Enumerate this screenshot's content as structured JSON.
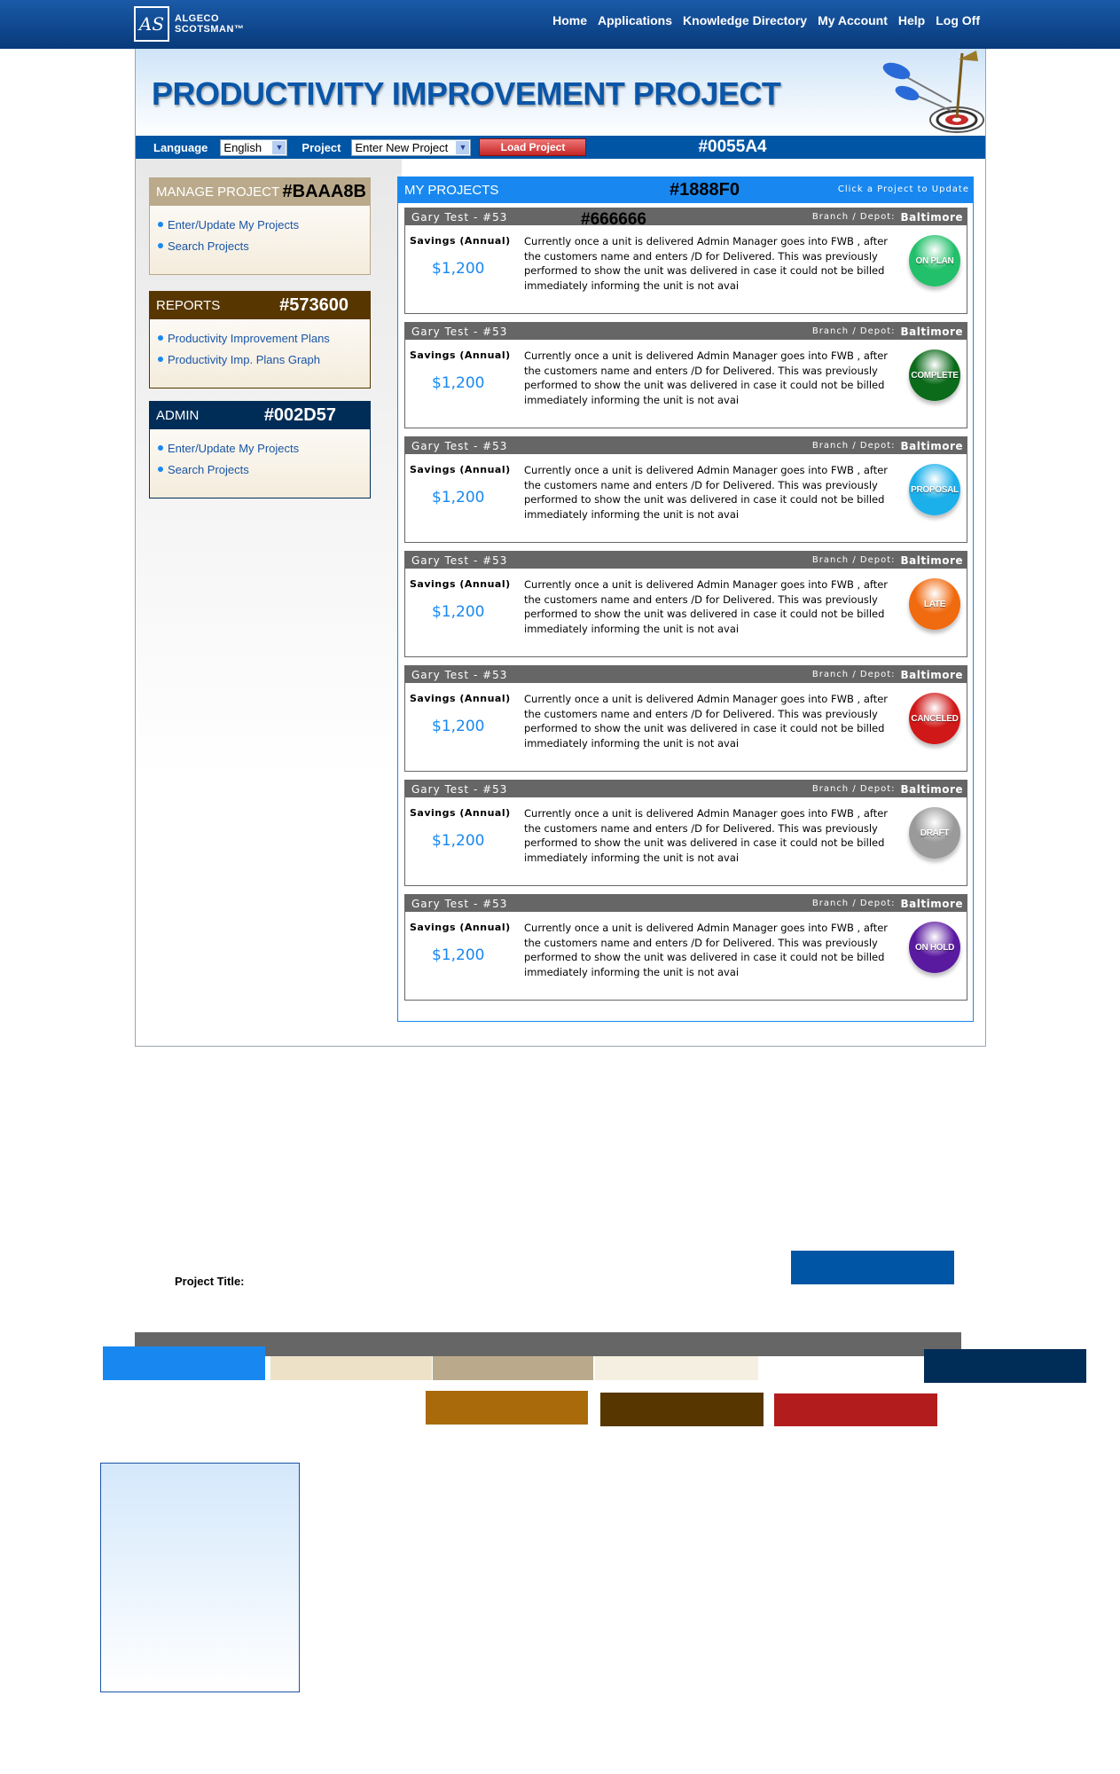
{
  "logo": {
    "mark": "AS",
    "line1": "ALGECO",
    "line2": "SCOTSMAN™"
  },
  "nav": [
    "Home",
    "Applications",
    "Knowledge Directory",
    "My Account",
    "Help",
    "Log Off"
  ],
  "banner": {
    "title": "PRODUCTIVITY IMPROVEMENT PROJECT"
  },
  "toolbar": {
    "language_label": "Language",
    "language_value": "English",
    "project_label": "Project",
    "project_value": "Enter New Project",
    "load_button": "Load Project",
    "swatch_label": "#0055A4"
  },
  "sidebar": {
    "manage": {
      "title": "MANAGE PROJECT",
      "hex": "#BAAA8B",
      "color": "#BAAA8B",
      "links": [
        "Enter/Update My Projects",
        "Search Projects"
      ]
    },
    "reports": {
      "title": "REPORTS",
      "hex": "#573600",
      "color": "#573600",
      "links": [
        "Productivity Improvement Plans",
        "Productivity Imp. Plans Graph"
      ]
    },
    "admin": {
      "title": "ADMIN",
      "hex": "#002D57",
      "color": "#002D57",
      "links": [
        "Enter/Update My Projects",
        "Search Projects"
      ]
    }
  },
  "projects": {
    "title": "MY PROJECTS",
    "hex": "#1888F0",
    "hint": "Click a Project to Update",
    "card_hex": "#666666",
    "cards": [
      {
        "name": "Gary Test - #53",
        "branch_label": "Branch / Depot:",
        "branch": "Baltimore",
        "savings_label": "Savings (Annual)",
        "savings": "$1,200",
        "desc": "Currently once a unit is delivered Admin Manager goes into FWB , after the customers name and enters /D for Delivered. This was previously performed to show the unit was delivered in case it could not be billed immediately informing the unit is not avai",
        "status": "ON PLAN",
        "status_color": "#22c06a"
      },
      {
        "name": "Gary Test - #53",
        "branch_label": "Branch / Depot:",
        "branch": "Baltimore",
        "savings_label": "Savings (Annual)",
        "savings": "$1,200",
        "desc": "Currently once a unit is delivered Admin Manager goes into FWB , after the customers name and enters /D for Delivered. This was previously performed to show the unit was delivered in case it could not be billed immediately informing the unit is not avai",
        "status": "COMPLETE",
        "status_color": "#0b6b1a"
      },
      {
        "name": "Gary Test - #53",
        "branch_label": "Branch / Depot:",
        "branch": "Baltimore",
        "savings_label": "Savings (Annual)",
        "savings": "$1,200",
        "desc": "Currently once a unit is delivered Admin Manager goes into FWB , after the customers name and enters /D for Delivered. This was previously performed to show the unit was delivered in case it could not be billed immediately informing the unit is not avai",
        "status": "PROPOSAL",
        "status_color": "#1cb0ea"
      },
      {
        "name": "Gary Test - #53",
        "branch_label": "Branch / Depot:",
        "branch": "Baltimore",
        "savings_label": "Savings (Annual)",
        "savings": "$1,200",
        "desc": "Currently once a unit is delivered Admin Manager goes into FWB , after the customers name and enters /D for Delivered. This was previously performed to show the unit was delivered in case it could not be billed immediately informing the unit is not avai",
        "status": "LATE",
        "status_color": "#f06a10"
      },
      {
        "name": "Gary Test - #53",
        "branch_label": "Branch / Depot:",
        "branch": "Baltimore",
        "savings_label": "Savings (Annual)",
        "savings": "$1,200",
        "desc": "Currently once a unit is delivered Admin Manager goes into FWB , after the customers name and enters /D for Delivered. This was previously performed to show the unit was delivered in case it could not be billed immediately informing the unit is not avai",
        "status": "CANCELED",
        "status_color": "#d01818"
      },
      {
        "name": "Gary Test - #53",
        "branch_label": "Branch / Depot:",
        "branch": "Baltimore",
        "savings_label": "Savings (Annual)",
        "savings": "$1,200",
        "desc": "Currently once a unit is delivered Admin Manager goes into FWB , after the customers name and enters /D for Delivered. This was previously performed to show the unit was delivered in case it could not be billed immediately informing the unit is not avai",
        "status": "DRAFT",
        "status_color": "#9a9a9a"
      },
      {
        "name": "Gary Test - #53",
        "branch_label": "Branch / Depot:",
        "branch": "Baltimore",
        "savings_label": "Savings (Annual)",
        "savings": "$1,200",
        "desc": "Currently once a unit is delivered Admin Manager goes into FWB , after the customers name and enters /D for Delivered. This was previously performed to show the unit was delivered in case it could not be billed immediately informing the unit is not avai",
        "status": "ON HOLD",
        "status_color": "#5a1aa0"
      }
    ]
  },
  "project_title_label": "Project Title:",
  "swatches": {
    "blue_button": "#0055A4",
    "gray_bar": "#666666",
    "row1": [
      "#1888F0",
      "#EDE2C8",
      "#BAAA8B",
      "#F4EFE0",
      "#FFFFFF",
      "#002D57"
    ],
    "row2": [
      "#A86A0A",
      "#573600",
      "#B31C1C"
    ]
  }
}
